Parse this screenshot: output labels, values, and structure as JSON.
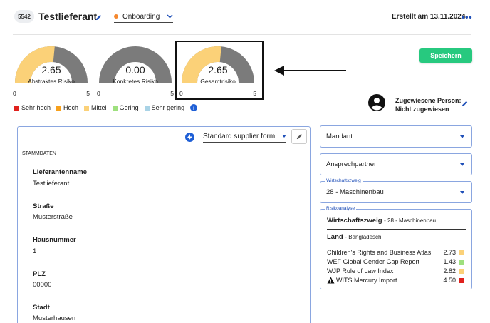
{
  "header": {
    "id_badge": "5542",
    "title": "Testlieferant",
    "status": "Onboarding",
    "status_color": "#f5882e",
    "created": "Erstellt am 13.11.2024",
    "more": "•••"
  },
  "gauges": [
    {
      "value": "2.65",
      "value_num": 2.65,
      "label": "Abstraktes Risiko",
      "min": "0",
      "max": "5",
      "fill_color": "#fbd178",
      "track_color": "#7b7b7b"
    },
    {
      "value": "0.00",
      "value_num": 0.0,
      "label": "Konkretes Risiko",
      "min": "0",
      "max": "5",
      "fill_color": "#fbd178",
      "track_color": "#7b7b7b"
    },
    {
      "value": "2.65",
      "value_num": 2.65,
      "label": "Gesamtrisiko",
      "min": "0",
      "max": "5",
      "fill_color": "#fbd178",
      "track_color": "#7b7b7b"
    }
  ],
  "save_label": "Speichern",
  "legend": [
    {
      "label": "Sehr hoch",
      "color": "#e0211d"
    },
    {
      "label": "Hoch",
      "color": "#f7a01c"
    },
    {
      "label": "Mittel",
      "color": "#fbd178"
    },
    {
      "label": "Gering",
      "color": "#9ee07e"
    },
    {
      "label": "Sehr gering",
      "color": "#a9d3e6"
    }
  ],
  "assigned": {
    "line1": "Zugewiesene Person:",
    "line2": "Nicht zugewiesen"
  },
  "form": {
    "template": "Standard supplier form",
    "section": "STAMMDATEN",
    "fields": [
      {
        "label": "Lieferantenname",
        "value": "Testlieferant"
      },
      {
        "label": "Straße",
        "value": "Musterstraße"
      },
      {
        "label": "Hausnummer",
        "value": "1"
      },
      {
        "label": "PLZ",
        "value": "00000"
      },
      {
        "label": "Stadt",
        "value": "Musterhausen"
      }
    ]
  },
  "side": {
    "mandant": "Mandant",
    "ansprechpartner": "Ansprechpartner",
    "wirtschaftszweig_label": "Wirtschaftszweig",
    "wirtschaftszweig_value": "28 - Maschinenbau"
  },
  "risk": {
    "title": "Risikoanalyse",
    "branch_label": "Wirtschaftszweig",
    "branch_value": "- 28 - Maschinenbau",
    "country_label": "Land",
    "country_value": "- Bangladesch",
    "rows": [
      {
        "name": "Children's Rights and Business Atlas",
        "value": "2.73",
        "color": "#fbd178",
        "warning": false
      },
      {
        "name": "WEF Global Gender Gap Report",
        "value": "1.43",
        "color": "#9ee07e",
        "warning": false
      },
      {
        "name": "WJP Rule of Law Index",
        "value": "2.82",
        "color": "#fbd178",
        "warning": false
      },
      {
        "name": "WITS Mercury Import",
        "value": "4.50",
        "color": "#e0211d",
        "warning": true
      }
    ]
  }
}
